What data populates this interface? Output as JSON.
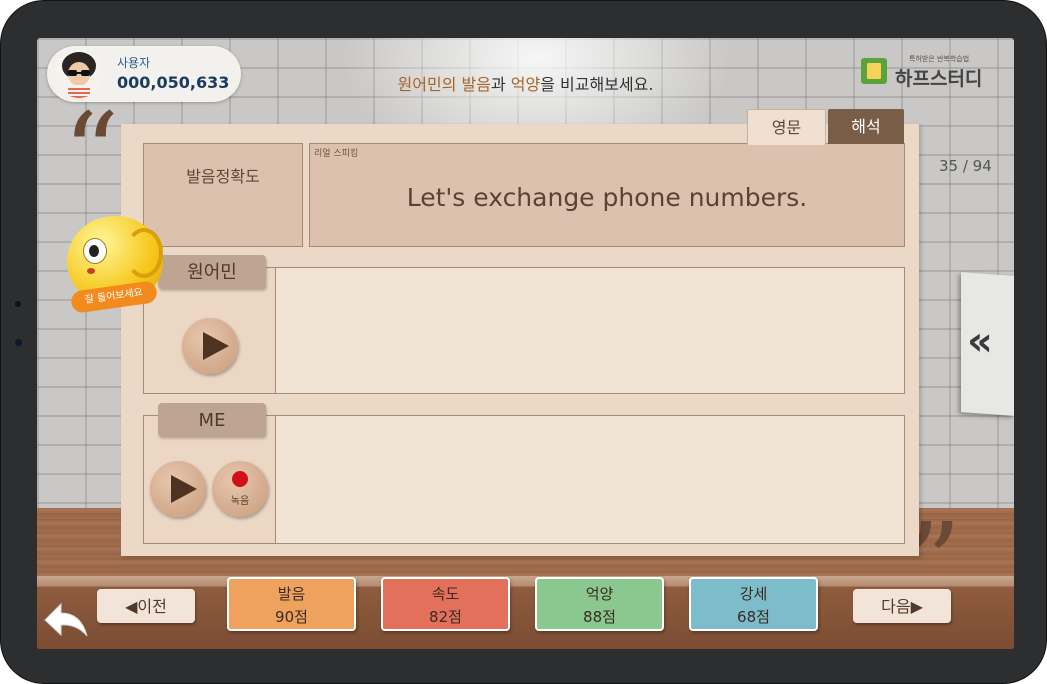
{
  "user": {
    "name": "사용자",
    "score": "000,050,633"
  },
  "header": {
    "instruction_parts": [
      {
        "text": "원어민의 ",
        "highlight": true
      },
      {
        "text": "발음",
        "highlight": true
      },
      {
        "text": "과 ",
        "highlight": false
      },
      {
        "text": "억양",
        "highlight": true
      },
      {
        "text": "을 비교해보세요.",
        "highlight": false
      }
    ],
    "logo_small": "특허받은 반복학습법",
    "logo_text": "하프스터디"
  },
  "tabs": [
    {
      "label": "영문",
      "active": true
    },
    {
      "label": "해석",
      "active": false
    }
  ],
  "card": {
    "accuracy_label": "발음정확도",
    "sentence_tag": "리얼 스피킹",
    "sentence": "Let's exchange phone numbers.",
    "native_label": "원어민",
    "me_label": "ME",
    "record_label": "녹음"
  },
  "counter": "35 / 94",
  "mascot_label": "잘 들어보세요",
  "nav": {
    "prev": "◀이전",
    "next": "다음▶"
  },
  "scores": [
    {
      "label": "발음",
      "value": "90점",
      "color": "#eea25e"
    },
    {
      "label": "속도",
      "value": "82점",
      "color": "#e2705a"
    },
    {
      "label": "억양",
      "value": "88점",
      "color": "#8ac88f"
    },
    {
      "label": "강세",
      "value": "68점",
      "color": "#7cbccb"
    }
  ],
  "icons": {
    "side_panel": "double-chevron-left-icon",
    "back": "back-arrow-icon",
    "play": "play-icon",
    "record": "record-icon"
  }
}
